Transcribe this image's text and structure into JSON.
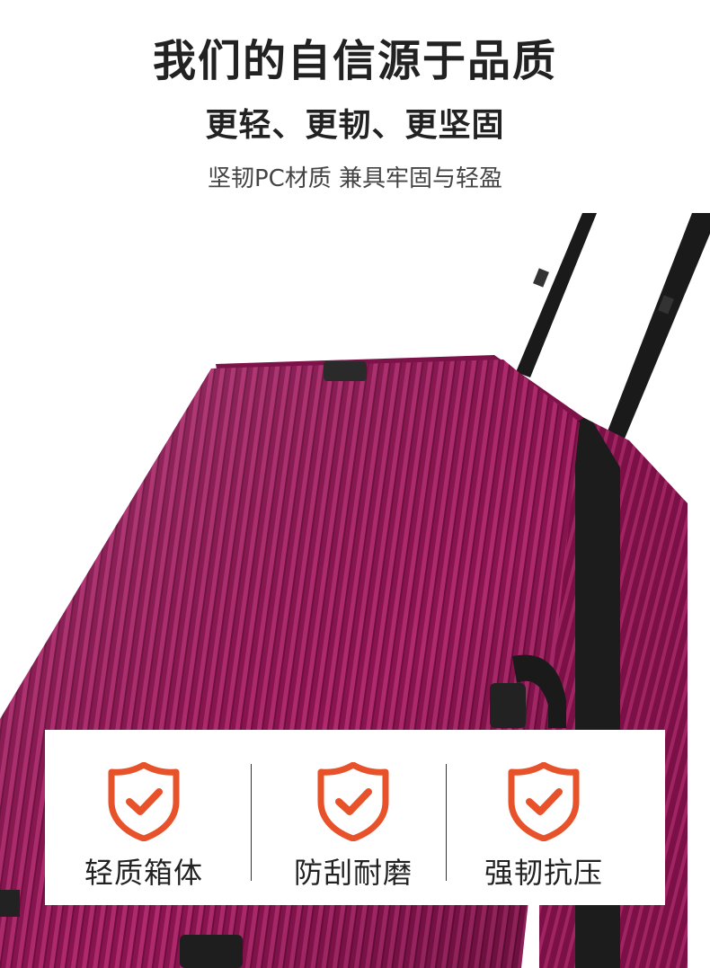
{
  "header": {
    "headline": "我们的自信源于品质",
    "subhead": "更轻、更韧、更坚固",
    "tagline": "坚韧PC材质 兼具牢固与轻盈"
  },
  "product": {
    "shell_color": "#8a1450",
    "handle_color": "#1a1a1a"
  },
  "features": [
    {
      "label": "轻质箱体",
      "icon": "shield-check-icon"
    },
    {
      "label": "防刮耐磨",
      "icon": "shield-check-icon"
    },
    {
      "label": "强韧抗压",
      "icon": "shield-check-icon"
    }
  ],
  "accent_color": "#e8522a"
}
